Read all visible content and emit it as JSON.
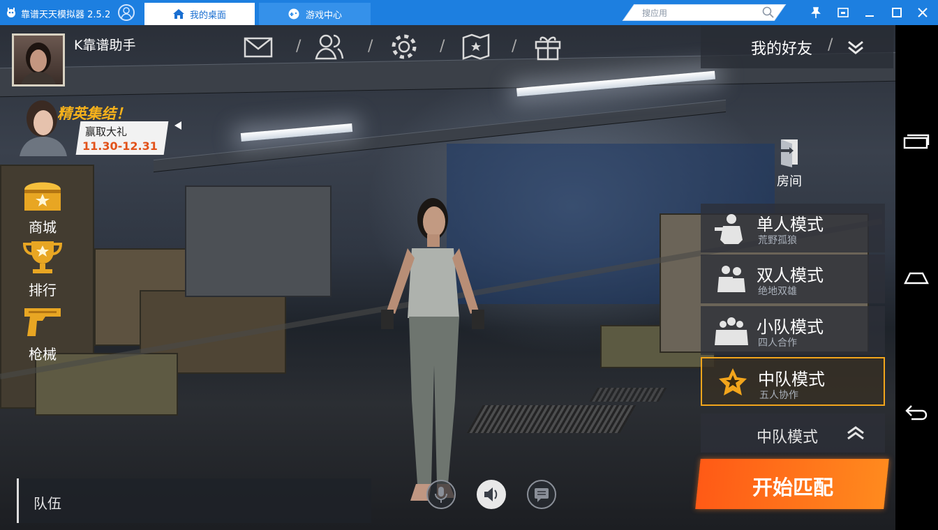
{
  "titlebar": {
    "app_name": "靠谱天天模拟器 2.5.2",
    "tabs": [
      {
        "label": "我的桌面"
      },
      {
        "label": "游戏中心"
      }
    ],
    "search_placeholder": "搜应用",
    "accent": "#1d7fe0"
  },
  "player": {
    "name": "K靠谱助手"
  },
  "top_icons": [
    "mail-icon",
    "friends-icon",
    "settings-icon",
    "map-icon",
    "gift-icon"
  ],
  "friends": {
    "label": "我的好友"
  },
  "promo": {
    "title": "精英集结！",
    "subtitle": "赢取大礼",
    "dates": "11.30-12.31"
  },
  "left_menu": [
    {
      "label": "商城"
    },
    {
      "label": "排行"
    },
    {
      "label": "枪械"
    }
  ],
  "room": {
    "label": "房间"
  },
  "modes": [
    {
      "name": "单人模式",
      "sub": "荒野孤狼"
    },
    {
      "name": "双人模式",
      "sub": "绝地双雄"
    },
    {
      "name": "小队模式",
      "sub": "四人合作"
    },
    {
      "name": "中队模式",
      "sub": "五人协作",
      "selected": true
    }
  ],
  "mode_select": {
    "label": "中队模式"
  },
  "start": {
    "label": "开始匹配",
    "color": "#ff6a1a"
  },
  "team": {
    "label": "队伍"
  }
}
